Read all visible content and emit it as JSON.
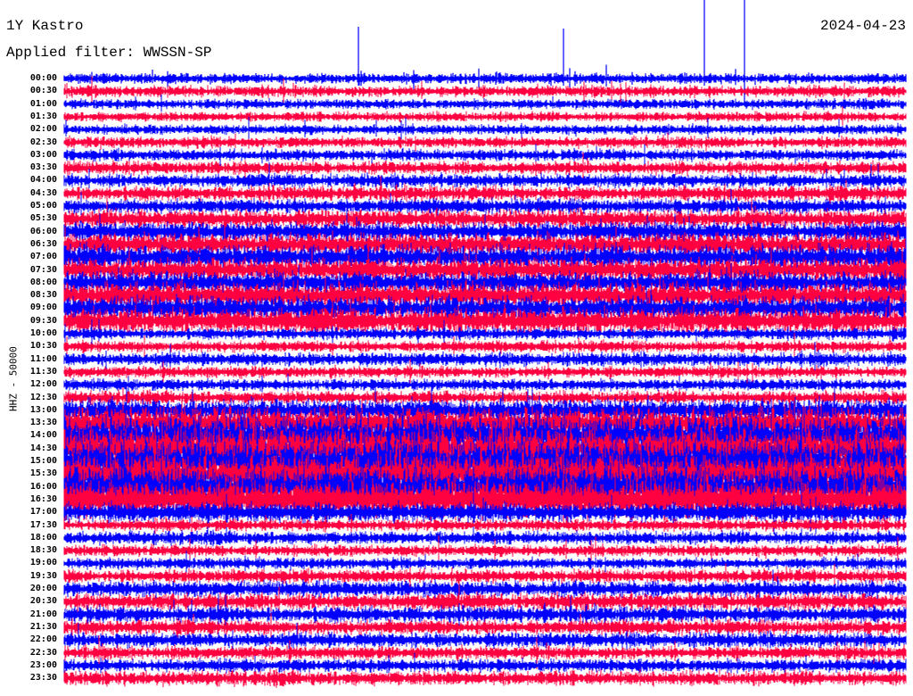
{
  "header": {
    "station": "1Y Kastro",
    "filter": "Applied filter: WWSSN-SP",
    "date": "2024-04-23"
  },
  "chart_data": {
    "type": "line",
    "title": "1Y Kastro",
    "subtitle": "Applied filter: WWSSN-SP",
    "ylabel": "HHZ - 50000",
    "xlabel": "",
    "row_labels": [
      "00:00",
      "00:30",
      "01:00",
      "01:30",
      "02:00",
      "02:30",
      "03:00",
      "03:30",
      "04:00",
      "04:30",
      "05:00",
      "05:30",
      "06:00",
      "06:30",
      "07:00",
      "07:30",
      "08:00",
      "08:30",
      "09:00",
      "09:30",
      "10:00",
      "10:30",
      "11:00",
      "11:30",
      "12:00",
      "12:30",
      "13:00",
      "13:30",
      "14:00",
      "14:30",
      "15:00",
      "15:30",
      "16:00",
      "16:30",
      "17:00",
      "17:30",
      "18:00",
      "18:30",
      "19:00",
      "19:30",
      "20:00",
      "20:30",
      "21:00",
      "21:30",
      "22:00",
      "22:30",
      "23:00",
      "23:30"
    ],
    "row_activity": [
      6,
      7,
      6,
      6,
      6,
      7,
      7,
      8,
      8,
      9,
      9,
      11,
      12,
      14,
      15,
      15,
      14,
      16,
      15,
      16,
      7,
      7,
      8,
      7,
      7,
      8,
      14,
      20,
      24,
      26,
      26,
      26,
      25,
      24,
      12,
      7,
      8,
      7,
      7,
      8,
      10,
      10,
      10,
      9,
      9,
      8,
      8,
      9
    ],
    "series_colors": [
      "#0000ff",
      "#ff0040"
    ]
  }
}
